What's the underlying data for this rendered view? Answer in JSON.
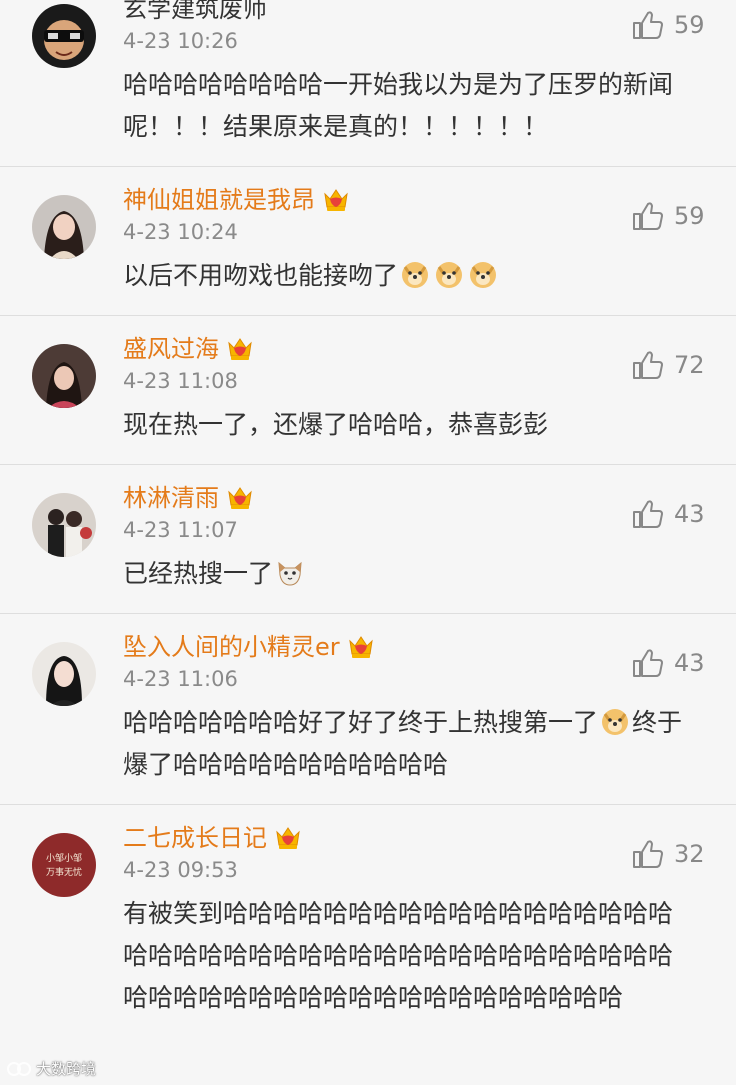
{
  "colors": {
    "background": "#f6f6f6",
    "username": "#e47b1a",
    "text": "#333333",
    "meta": "#8a8a8a",
    "divider": "#dedede"
  },
  "comments": [
    {
      "username": "玄学建筑废师",
      "username_style": "plain",
      "member_badge": false,
      "time": "4-23 10:26",
      "likes": "59",
      "avatar_icon": "avatar-sunglasses-icon",
      "text": "哈哈哈哈哈哈哈哈一开始我以为是为了压罗的新闻呢！！！结果原来是真的！！！！！！",
      "emojis": []
    },
    {
      "username": "神仙姐姐就是我昂",
      "username_style": "vip",
      "member_badge": true,
      "time": "4-23 10:24",
      "likes": "59",
      "avatar_icon": "avatar-woman-icon",
      "text": "以后不用吻戏也能接吻了",
      "emojis": [
        "doge-emoji",
        "doge-emoji",
        "doge-emoji"
      ]
    },
    {
      "username": "盛风过海",
      "username_style": "vip",
      "member_badge": true,
      "time": "4-23 11:08",
      "likes": "72",
      "avatar_icon": "avatar-woman-icon",
      "text": "现在热一了，还爆了哈哈哈，恭喜彭彭",
      "emojis": []
    },
    {
      "username": "林淋清雨",
      "username_style": "vip",
      "member_badge": true,
      "time": "4-23 11:07",
      "likes": "43",
      "avatar_icon": "avatar-couple-icon",
      "text": "已经热搜一了",
      "emojis": [
        "cat-emoji"
      ]
    },
    {
      "username": "坠入人间的小精灵er",
      "username_style": "vip",
      "member_badge": true,
      "time": "4-23 11:06",
      "likes": "43",
      "avatar_icon": "avatar-woman-icon",
      "text": "哈哈哈哈哈哈哈好了好了终于上热搜第一了",
      "emojis": [
        "doge-emoji"
      ],
      "text_after_emoji": "终于爆了哈哈哈哈哈哈哈哈哈哈哈"
    },
    {
      "username": "二七成长日记",
      "username_style": "vip",
      "member_badge": true,
      "time": "4-23 09:53",
      "likes": "32",
      "avatar_icon": "avatar-red-badge-icon",
      "avatar_text_line1": "小邹小邹",
      "avatar_text_line2": "万事无忧",
      "text": "有被笑到哈哈哈哈哈哈哈哈哈哈哈哈哈哈哈哈哈哈哈哈哈哈哈哈哈哈哈哈哈哈哈哈哈哈哈哈哈哈哈哈哈哈哈哈哈哈哈哈哈哈哈哈哈哈哈哈哈哈哈哈",
      "emojis": []
    }
  ],
  "watermark": {
    "text": "大数跨境"
  }
}
